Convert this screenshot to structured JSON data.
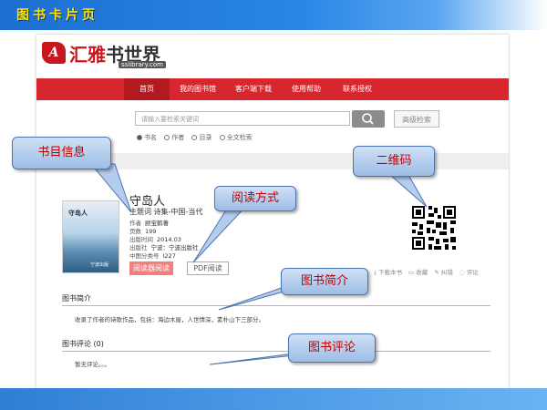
{
  "slide": {
    "title": "图书卡片页"
  },
  "logo": {
    "main": "汇雅",
    "main2": "书世界",
    "mark": "A",
    "sub": "sslibrary.com"
  },
  "nav": {
    "items": [
      "首页",
      "我的图书馆",
      "客户端下载",
      "使用帮助",
      "联系授权"
    ],
    "active": 0
  },
  "search": {
    "placeholder": "请输入要检索关键词",
    "advanced_label": "高级检索",
    "options": [
      "书名",
      "作者",
      "目录",
      "全文检索"
    ],
    "selected": 0
  },
  "book": {
    "cover_title": "守岛人",
    "cover_publisher": "宁波出版",
    "title": "守岛人",
    "subject_label": "主题词",
    "subject": "诗集-中国-当代",
    "meta": [
      {
        "label": "作者",
        "value": "顾宝鹤著"
      },
      {
        "label": "页数",
        "value": "199"
      },
      {
        "label": "出版时间",
        "value": "2014.03"
      },
      {
        "label": "出版社",
        "value": "宁波：宁波出版社"
      },
      {
        "label": "中图分类号",
        "value": "I227"
      }
    ],
    "online_read": "阅读器阅读",
    "pdf_read": "PDF阅读"
  },
  "actions": [
    "下载本书",
    "收藏",
    "纠错",
    "评论"
  ],
  "intro": {
    "title": "图书简介",
    "text": "收录了作者的诗歌作品，包括：海边木屋，人世情深，素朴山下三部分。"
  },
  "reviews": {
    "title": "图书评论",
    "count": "(0)",
    "text": "暂无评论。。。"
  },
  "callouts": {
    "catalog": "书目信息",
    "read_mode": "阅读方式",
    "qrcode": "二维码",
    "intro": "图书简介",
    "review": "图书评论"
  },
  "colors": {
    "brand_red": "#d8262e",
    "header_blue": "#1c6fd0",
    "slide_title": "#ffe400",
    "callout_text": "#c00000"
  }
}
